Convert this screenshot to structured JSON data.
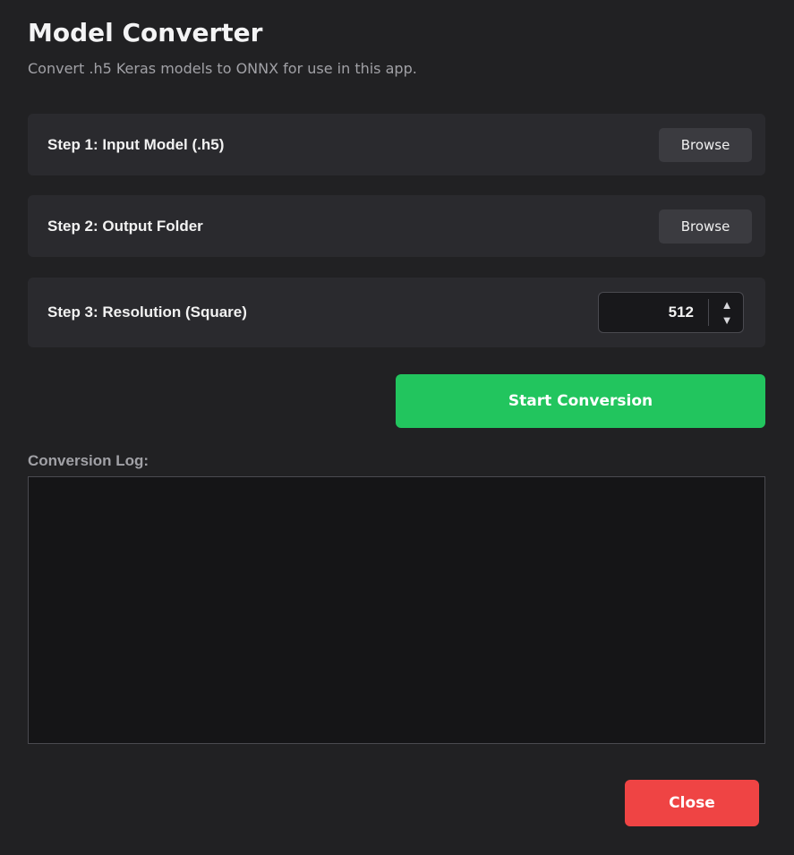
{
  "window": {
    "title": "Model Converter",
    "subtitle": "Convert .h5 Keras models to ONNX for use in this app."
  },
  "steps": [
    {
      "label": "Step 1: Input Model (.h5)",
      "button": "Browse"
    },
    {
      "label": "Step 2: Output Folder",
      "button": "Browse"
    },
    {
      "label": "Step 3: Resolution (Square)",
      "value": "512"
    }
  ],
  "spin_icons": {
    "up": "▲",
    "down": "▼"
  },
  "actions": {
    "start": "Start Conversion",
    "close": "Close"
  },
  "log": {
    "label": "Conversion Log:",
    "content": ""
  },
  "colors": {
    "background": "#212123",
    "panel": "#2a2a2e",
    "start": "#22c55e",
    "close": "#ef4444"
  }
}
